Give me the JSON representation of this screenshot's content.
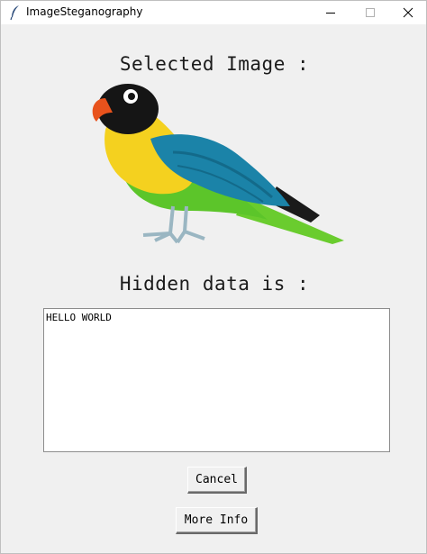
{
  "window": {
    "title": "ImageSteganography",
    "icon": "feather-icon"
  },
  "main": {
    "selected_heading": "Selected Image :",
    "hidden_heading": "Hidden data is :",
    "hidden_text": "HELLO WORLD",
    "image_subject": "parrot-illustration"
  },
  "buttons": {
    "cancel_label": "Cancel",
    "more_info_label": "More Info"
  }
}
